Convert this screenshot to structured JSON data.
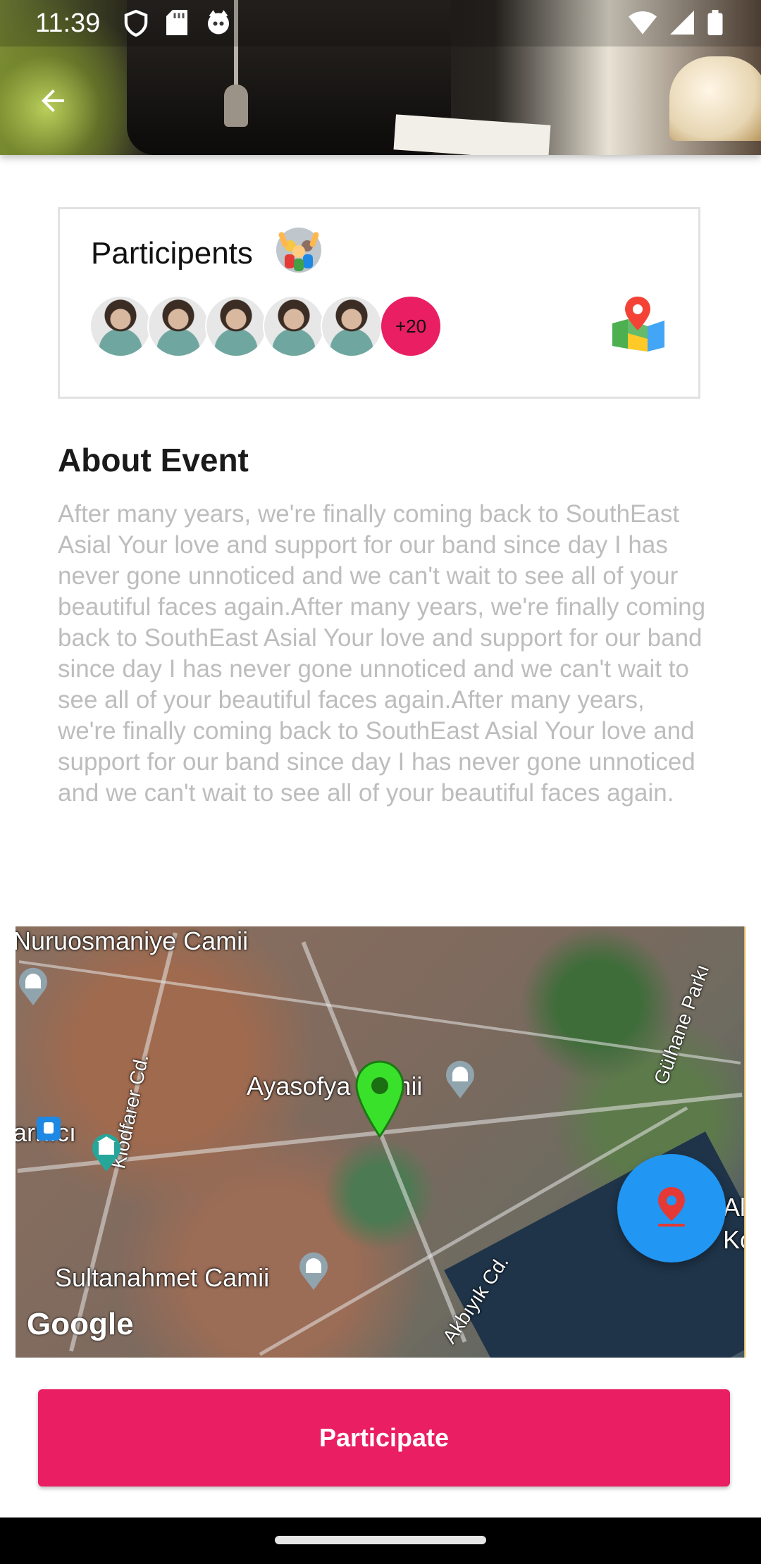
{
  "status_bar": {
    "time": "11:39",
    "left_icons": [
      "shield-icon",
      "sd-card-icon",
      "cat-icon"
    ],
    "right_icons": [
      "wifi-icon",
      "signal-icon",
      "battery-icon"
    ]
  },
  "header": {
    "back_icon": "arrow-left-icon"
  },
  "participants_card": {
    "title": "Participents",
    "title_icon": "party-people-icon",
    "avatar_count_visible": 5,
    "more_badge": "+20",
    "map_icon": "map-pin-icon"
  },
  "about": {
    "title": "About Event",
    "text": "After many years, we're finally coming back to SouthEast Asial Your love and support for our band since day I has never gone unnoticed and we can't wait to see all of your beautiful faces again.After many years, we're finally coming back to SouthEast Asial Your love and support for our band since day I has never gone unnoticed and we can't wait to see all of your beautiful faces again.After many years, we're finally coming back to SouthEast Asial Your love and support for our band since day I has never gone unnoticed and we can't wait to see all of your beautiful faces again."
  },
  "map": {
    "labels": {
      "nuruosmaniye": "Nuruosmaniye Camii",
      "ayasofya": "Ayasofya Camii",
      "arnici": "arnıcı",
      "klodfarer": "Klodfarer Cd.",
      "sultanahmet": "Sultanahmet Camii",
      "akbiyik": "Akbıyık Cd.",
      "gulhane": "Gülhane Parkı",
      "edge1": "Al",
      "edge2": "Ko"
    },
    "attribution": "Google",
    "fab_icon": "location-pin-icon"
  },
  "actions": {
    "participate_label": "Participate"
  },
  "colors": {
    "accent": "#e91e63",
    "fab": "#2196f3",
    "about_text": "#bdbdbd"
  }
}
